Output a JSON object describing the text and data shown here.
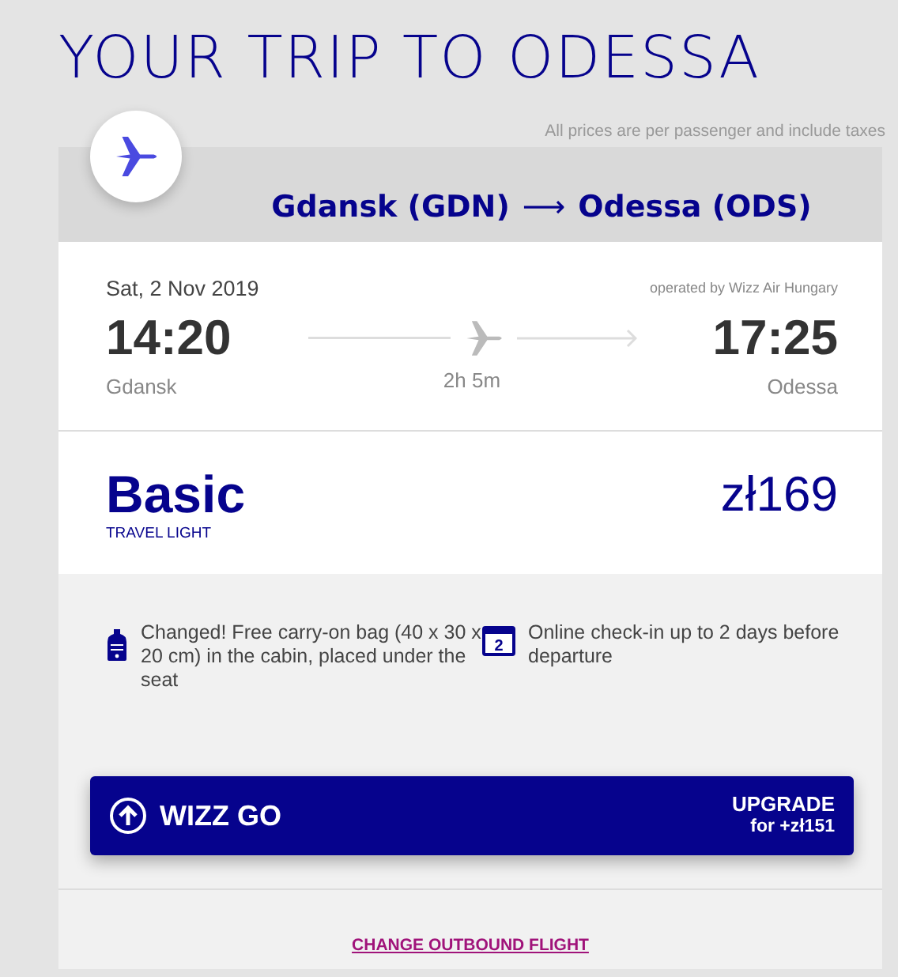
{
  "title": "YOUR TRIP TO ODESSA",
  "price_note": "All prices are per passenger and include taxes",
  "route": {
    "from": "Gdansk (GDN)",
    "arrow": "⟶",
    "to": "Odessa (ODS)"
  },
  "flight": {
    "date": "Sat, 2 Nov 2019",
    "operator": "operated by Wizz Air Hungary",
    "departure_time": "14:20",
    "departure_city": "Gdansk",
    "duration": "2h 5m",
    "arrival_time": "17:25",
    "arrival_city": "Odessa"
  },
  "fare": {
    "name": "Basic",
    "subtitle": "TRAVEL LIGHT",
    "price": "zł169"
  },
  "features": [
    {
      "kind": "bag",
      "text": "Changed! Free carry-on bag (40 x 30 x 20 cm) in the cabin, placed under the seat"
    },
    {
      "kind": "calendar",
      "day": "2",
      "text": "Online check-in up to 2 days before departure"
    }
  ],
  "upgrade": {
    "name": "WIZZ GO",
    "action": "UPGRADE",
    "price": "for +zł151"
  },
  "change_link": "CHANGE OUTBOUND FLIGHT"
}
